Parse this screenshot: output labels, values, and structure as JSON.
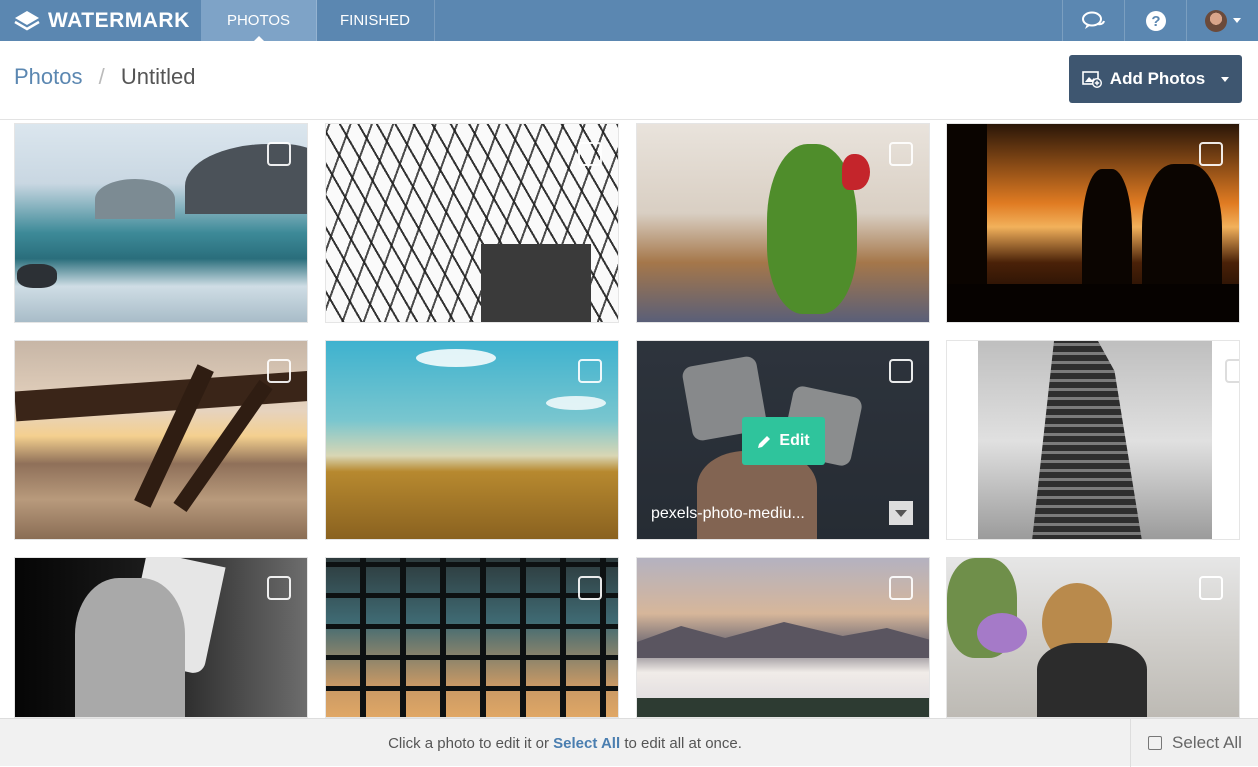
{
  "nav": {
    "brand": "WATERMARK",
    "tabs": [
      {
        "label": "PHOTOS",
        "active": true
      },
      {
        "label": "FINISHED",
        "active": false
      }
    ],
    "icons": [
      "chat-icon",
      "help-icon",
      "user-avatar"
    ]
  },
  "header": {
    "breadcrumb_root": "Photos",
    "breadcrumb_sep": "/",
    "breadcrumb_current": "Untitled",
    "add_button": "Add Photos"
  },
  "grid": {
    "hover_tile": {
      "edit_label": "Edit",
      "filename": "pexels-photo-mediu..."
    }
  },
  "footer": {
    "hint_prefix": "Click a photo to edit it or",
    "hint_link": "Select All",
    "hint_suffix": "to edit all at once.",
    "select_all": "Select All"
  },
  "colors": {
    "nav_bg": "#5b87b1",
    "nav_active": "#7ea3c7",
    "add_button_bg": "#3e5670",
    "edit_button_bg": "#2fc49c",
    "link": "#5b87b1"
  }
}
